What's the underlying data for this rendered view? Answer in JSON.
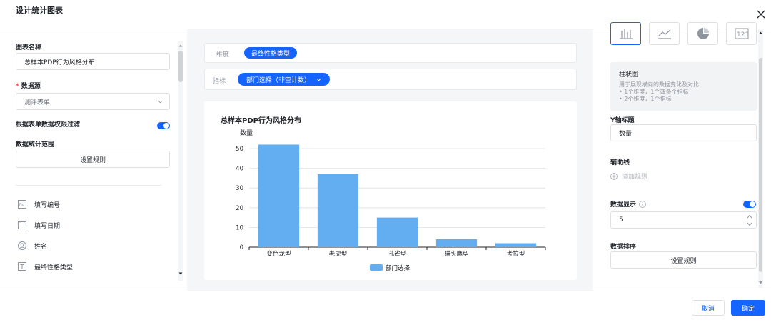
{
  "dialog": {
    "title": "设计统计图表"
  },
  "left": {
    "chart_name_label": "图表名称",
    "chart_name_value": "总样本PDP行为风格分布",
    "datasource_label": "数据源",
    "datasource_value": "测评表单",
    "permission_filter_label": "根据表单数据权限过滤",
    "stat_range_label": "数据统计范围",
    "set_rule": "设置规则",
    "fields": [
      "填写编号",
      "填写日期",
      "姓名",
      "最终性格类型"
    ]
  },
  "center": {
    "dimension_label": "维度",
    "dimension_value": "最终性格类型",
    "metric_label": "指标",
    "metric_value": "部门选择（非空计数）"
  },
  "chart_data": {
    "type": "bar",
    "title": "总样本PDP行为风格分布",
    "ylabel": "数量",
    "xlabel": "",
    "categories": [
      "变色龙型",
      "老虎型",
      "孔雀型",
      "猫头鹰型",
      "考拉型"
    ],
    "series": [
      {
        "name": "部门选择",
        "values": [
          52,
          37,
          15,
          4,
          2
        ]
      }
    ],
    "ylim": [
      0,
      50
    ],
    "yticks": [
      "0",
      "10",
      "20",
      "30",
      "40",
      "50"
    ],
    "grid": true,
    "legend": "bottom",
    "color": "#62aef0"
  },
  "right": {
    "chart_types": [
      "bar-chart-icon",
      "line-chart-icon",
      "pie-chart-icon",
      "number-card-icon"
    ],
    "desc_title": "柱状图",
    "desc_lines": [
      "用于展现横向的数据变化及对比",
      "• 1个维度，1个或多个指标",
      "• 2个维度，1个指标"
    ],
    "y_title_label": "Y轴标题",
    "y_title_value": "数量",
    "aux_line_label": "辅助线",
    "add_rule": "添加规则",
    "data_display_label": "数据显示",
    "data_display_value": "5",
    "sort_label": "数据排序",
    "set_rule": "设置规则"
  },
  "footer": {
    "cancel": "取消",
    "confirm": "确定"
  },
  "colors": {
    "accent": "#1664ff",
    "bar": "#62aef0",
    "required": "#f54a45"
  }
}
